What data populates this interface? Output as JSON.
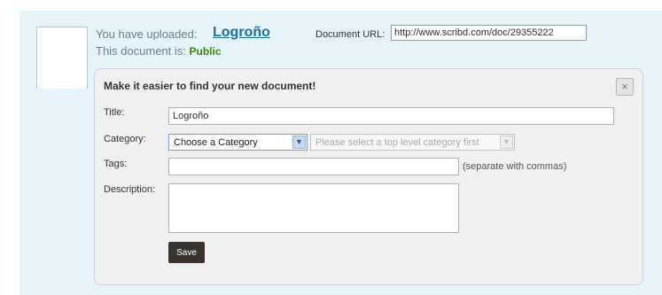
{
  "upload": {
    "uploaded_prefix": "You have uploaded:",
    "document_title": "Logroño",
    "url_label": "Document URL:",
    "url_value": "http://www.scribd.com/doc/29355222",
    "status_prefix": "This document is:",
    "status_value": "Public",
    "status_color": "#3a8a13"
  },
  "form": {
    "heading": "Make it easier to find your new document!",
    "close_label": "×",
    "title_label": "Title:",
    "title_value": "Logroño",
    "category_label": "Category:",
    "category_selected": "Choose a Category",
    "subcategory_placeholder": "Please select a top level category first",
    "tags_label": "Tags:",
    "tags_value": "",
    "tags_hint": "(separate with commas)",
    "description_label": "Description:",
    "description_value": "",
    "save_label": "Save"
  },
  "icons": {
    "dropdown": "chevron-down-icon",
    "close": "close-icon"
  }
}
